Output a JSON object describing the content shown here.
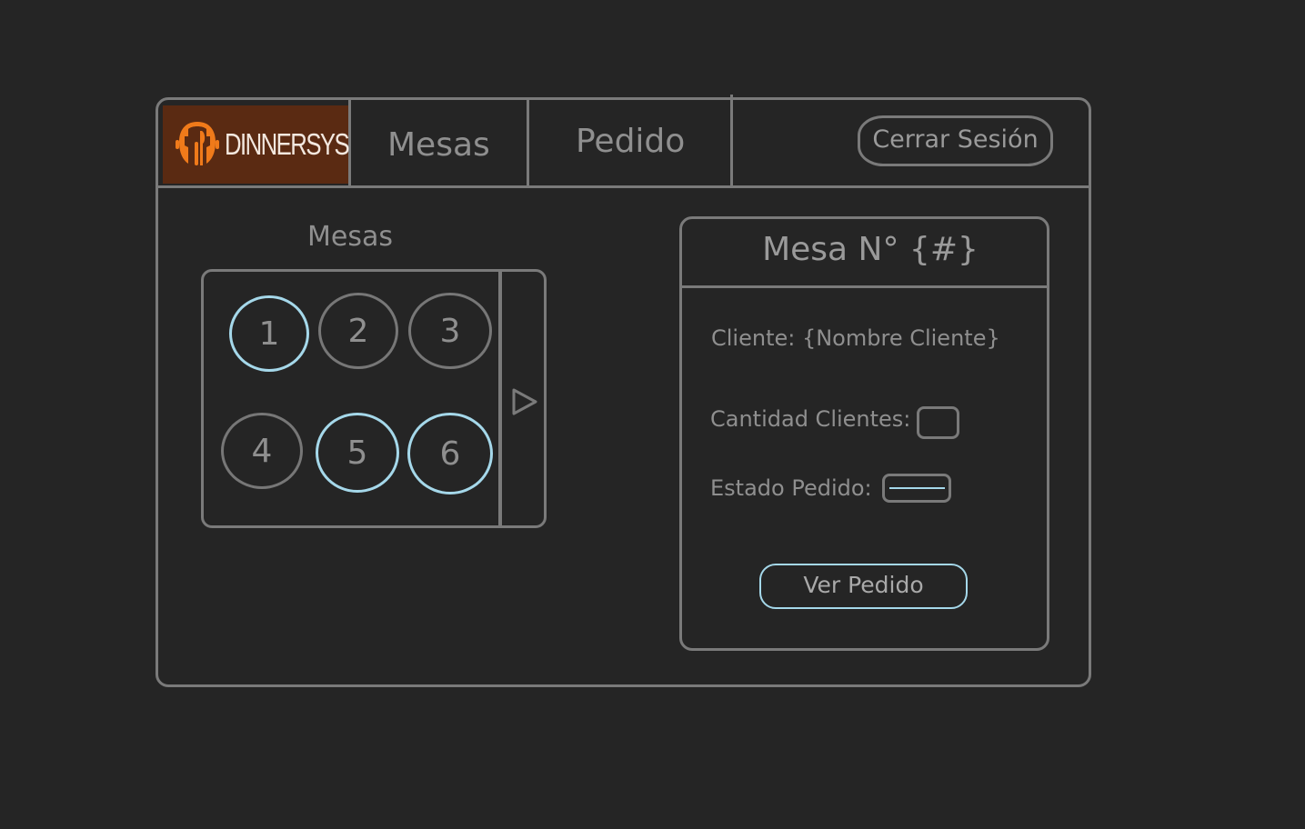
{
  "header": {
    "logo_text": "DINNERSYS",
    "nav": [
      {
        "label": "Mesas"
      },
      {
        "label": "Pedido"
      }
    ],
    "logout_label": "Cerrar Sesión"
  },
  "tables_section": {
    "title": "Mesas",
    "tables": [
      {
        "number": "1",
        "highlighted": true
      },
      {
        "number": "2",
        "highlighted": false
      },
      {
        "number": "3",
        "highlighted": false
      },
      {
        "number": "4",
        "highlighted": false
      },
      {
        "number": "5",
        "highlighted": true
      },
      {
        "number": "6",
        "highlighted": true
      }
    ],
    "scroll_icon": "triangle-right-icon"
  },
  "detail": {
    "title": "Mesa N° {#}",
    "client_label": "Cliente: {Nombre Cliente}",
    "quantity_label": "Cantidad Clientes:",
    "status_label": "Estado Pedido:",
    "view_order_label": "Ver Pedido"
  },
  "colors": {
    "background": "#252525",
    "outline": "#7a7a7a",
    "highlight": "#a5d8ea",
    "logo_bg": "#5a2a12",
    "logo_accent": "#f07a1a"
  }
}
